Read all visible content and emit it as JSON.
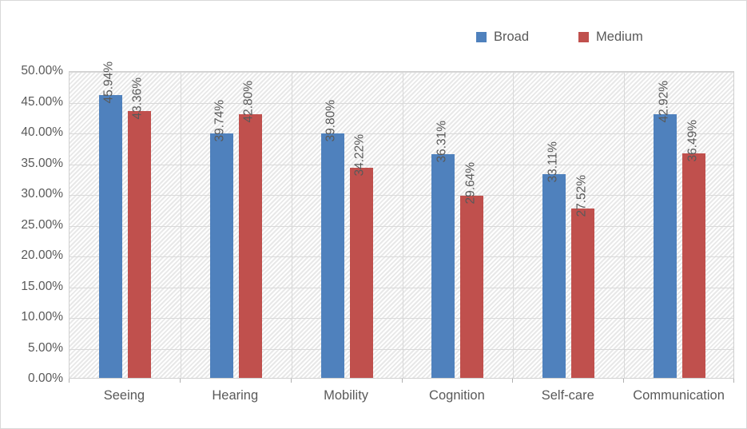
{
  "chart_data": {
    "type": "bar",
    "title": "",
    "subtitle": "",
    "xlabel": "",
    "ylabel": "",
    "categories": [
      "Seeing",
      "Hearing",
      "Mobility",
      "Cognition",
      "Self-care",
      "Communication"
    ],
    "series": [
      {
        "name": "Broad",
        "color": "#4f81bd",
        "values": [
          45.94,
          39.74,
          39.8,
          36.31,
          33.11,
          42.92
        ],
        "labels": [
          "45.94%",
          "39.74%",
          "39.80%",
          "36.31%",
          "33.11%",
          "42.92%"
        ]
      },
      {
        "name": "Medium",
        "color": "#c0504d",
        "values": [
          43.36,
          42.8,
          34.22,
          29.64,
          27.52,
          36.49
        ],
        "labels": [
          "43.36%",
          "42.80%",
          "34.22%",
          "29.64%",
          "27.52%",
          "36.49%"
        ]
      }
    ],
    "ylim": [
      0,
      50
    ],
    "ytick_step": 5,
    "ytick_labels": [
      "0.00%",
      "5.00%",
      "10.00%",
      "15.00%",
      "20.00%",
      "25.00%",
      "30.00%",
      "35.00%",
      "40.00%",
      "45.00%",
      "50.00%"
    ],
    "ytick_values": [
      0,
      5,
      10,
      15,
      20,
      25,
      30,
      35,
      40,
      45,
      50
    ],
    "grid": {
      "horizontal": true,
      "vertical": true,
      "plot_background": "hatched-diagonal",
      "gridline_color": "#d9d9d9"
    },
    "legend": {
      "position": "top-right",
      "entries": [
        {
          "label": "Broad",
          "color": "#4f81bd"
        },
        {
          "label": "Medium",
          "color": "#c0504d"
        }
      ]
    },
    "value_suffix": "%",
    "data_labels_rotated": true,
    "text_color": "#595959",
    "border_color": "#d9d9d9"
  }
}
